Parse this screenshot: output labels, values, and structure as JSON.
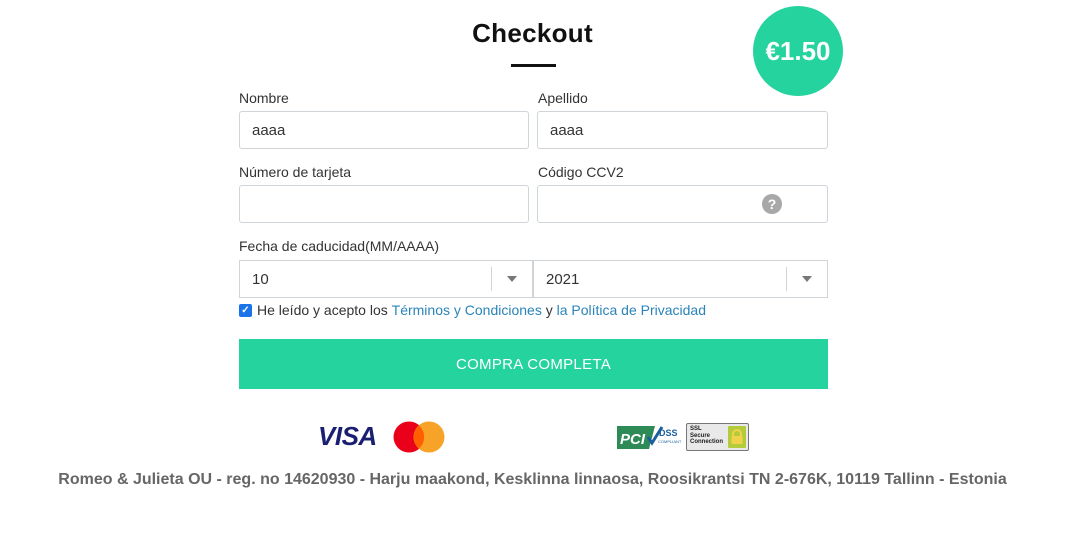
{
  "title": "Checkout",
  "price": "€1.50",
  "form": {
    "first_name_label": "Nombre",
    "first_name_value": "aaaa",
    "last_name_label": "Apellido",
    "last_name_value": "aaaa",
    "card_number_label": "Número de tarjeta",
    "card_number_value": "",
    "cvv_label": "Código CCV2",
    "cvv_value": "",
    "cvv_help_icon": "?",
    "expiry_label": "Fecha de caducidad(MM/AAAA)",
    "expiry_month": "10",
    "expiry_year": "2021"
  },
  "terms": {
    "checked": true,
    "prefix": "He leído y acepto los",
    "terms_link": "Términos y Condiciones",
    "connector": "y",
    "privacy_link": "la Política de Privacidad"
  },
  "submit_label": "COMPRA COMPLETA",
  "logos": {
    "visa": "VISA",
    "pci_text": "PCI",
    "pci_dss": "DSS",
    "pci_compliant": "COMPLIANT",
    "ssl_lines": [
      "SSL",
      "Secure",
      "Connection"
    ]
  },
  "footer": "Romeo & Julieta OU - reg. no 14620930 - Harju maakond, Kesklinna linnaosa, Roosikrantsi TN 2-676K, 10119 Tallinn - Estonia",
  "colors": {
    "accent": "#24d39d",
    "link": "#2a84b8",
    "checkbox": "#1a73e8"
  }
}
